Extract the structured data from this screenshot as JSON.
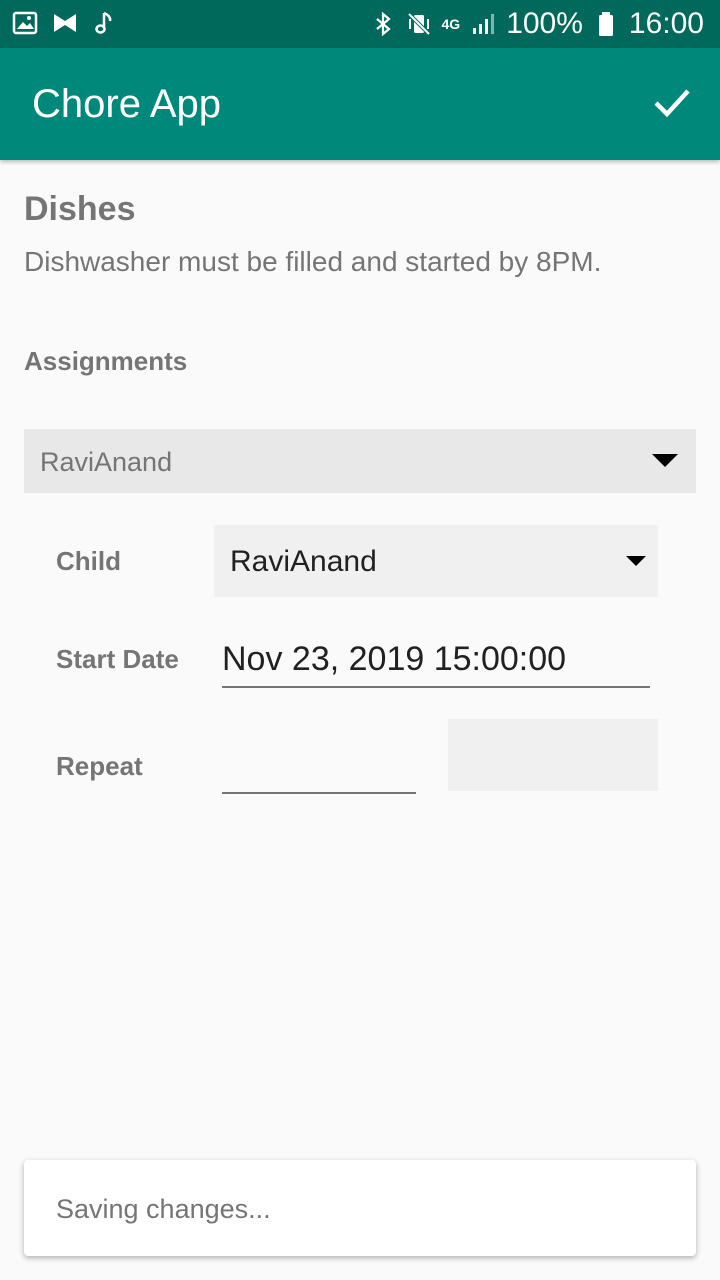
{
  "status_bar": {
    "battery": "100%",
    "time": "16:00",
    "network_label": "4G",
    "icons": [
      "image-icon",
      "bowtie-icon",
      "music-note-icon",
      "bluetooth-icon",
      "vibrate-mute-icon",
      "signal-icon",
      "battery-icon"
    ]
  },
  "app_bar": {
    "title": "Chore App",
    "action_icon": "check-icon"
  },
  "chore": {
    "title": "Dishes",
    "description": "Dishwasher must be filled and started by 8PM."
  },
  "assignments": {
    "label": "Assignments",
    "selected": "RaviAnand"
  },
  "form": {
    "child_label": "Child",
    "child_value": "RaviAnand",
    "start_date_label": "Start Date",
    "start_date_value": "Nov 23, 2019 15:00:00",
    "repeat_label": "Repeat",
    "repeat_value": "",
    "repeat_unit": ""
  },
  "snackbar": {
    "message": "Saving changes..."
  },
  "colors": {
    "primary": "#00897b",
    "primary_dark": "#00695c",
    "text_secondary": "#757575"
  }
}
